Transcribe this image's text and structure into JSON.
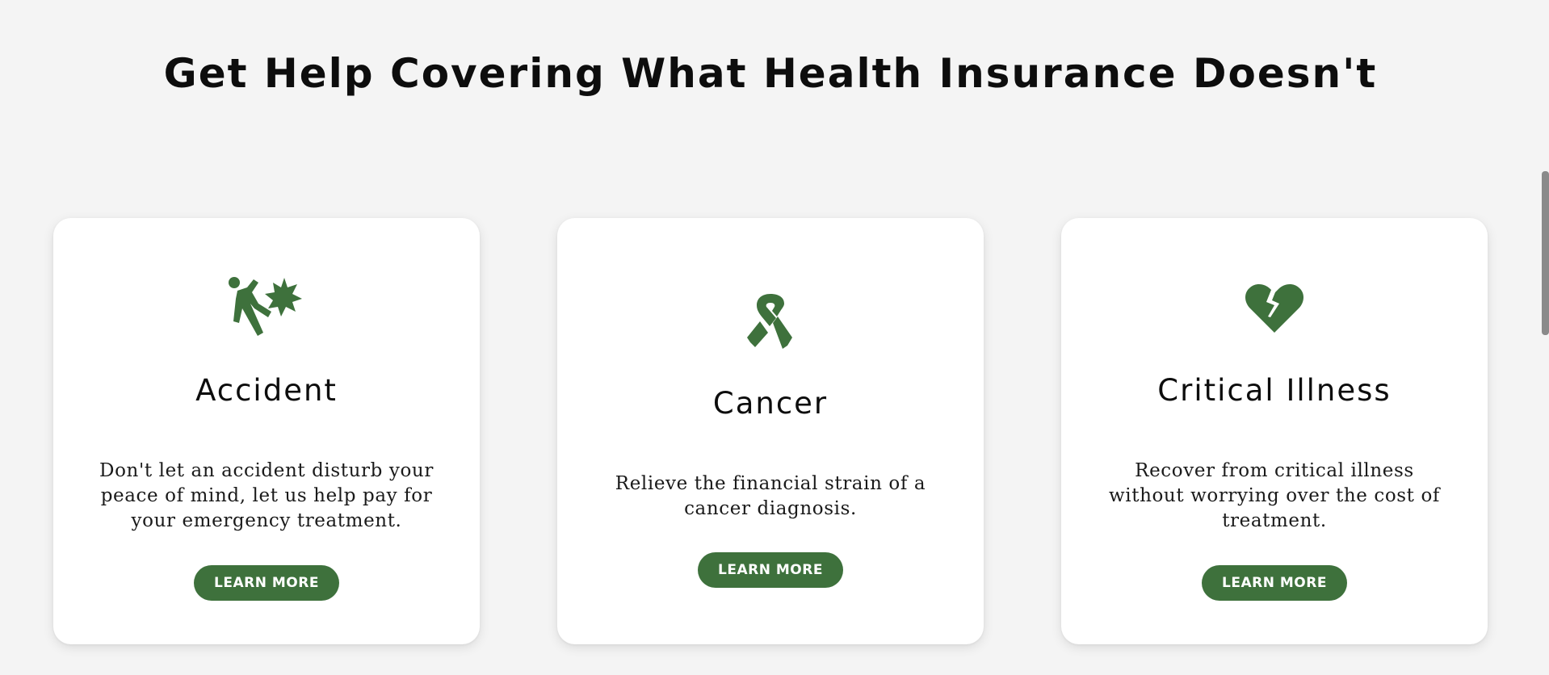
{
  "section": {
    "title": "Get Help Covering What Health Insurance Doesn't"
  },
  "theme": {
    "accent": "#3e713c",
    "background": "#f4f4f4",
    "card_background": "#ffffff"
  },
  "cards": [
    {
      "icon": "accident-fall-icon",
      "title": "Accident",
      "description": "Don't let an accident disturb your peace of mind, let us help pay for your emergency treatment.",
      "button_label": "LEARN MORE"
    },
    {
      "icon": "cancer-ribbon-icon",
      "title": "Cancer",
      "description": "Relieve the financial strain of a cancer diagnosis.",
      "button_label": "LEARN MORE"
    },
    {
      "icon": "broken-heart-icon",
      "title": "Critical Illness",
      "description": "Recover from critical illness without worrying over the cost of treatment.",
      "button_label": "LEARN MORE"
    }
  ]
}
